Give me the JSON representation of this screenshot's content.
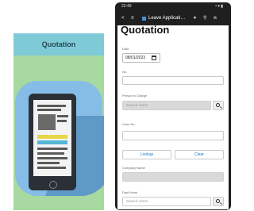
{
  "tile": {
    "title": "Quotation"
  },
  "phone": {
    "status_time": "22:49",
    "status_icons": "• ▾ ▮",
    "appbar": {
      "back": "<",
      "menu": "≡",
      "title": "Leave Applicati…",
      "dropdown": "▾",
      "search": "⚲",
      "bell": "⍾"
    },
    "form": {
      "title": "Quotation",
      "date_label": "Date",
      "date_value": "08/01/2023",
      "no_label": "No.",
      "person_label": "Person in Charge",
      "person_placeholder": "Search Users",
      "case_label": "Case No.",
      "lookup_label": "Lookup",
      "clear_label": "Clear",
      "company_label": "Company Name",
      "dept_label": "Dept Head",
      "dept_placeholder": "Search Users"
    }
  }
}
